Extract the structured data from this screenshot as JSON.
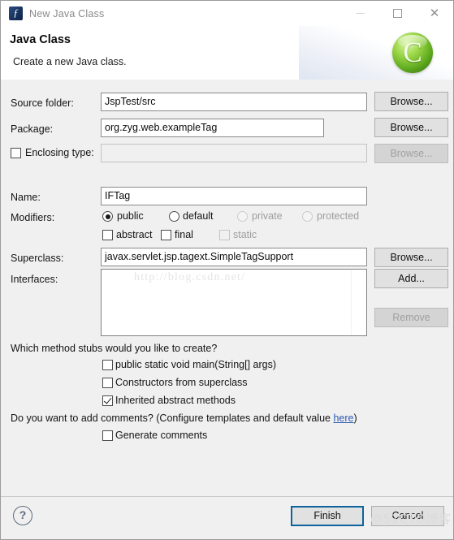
{
  "window": {
    "title": "New Java Class",
    "icon": "java-class-icon",
    "controls": {
      "minimize": "minimize-icon",
      "maximize": "maximize-icon",
      "close": "close-icon"
    }
  },
  "header": {
    "title": "Java Class",
    "subtitle": "Create a new Java class.",
    "logo": "green-c-logo"
  },
  "form": {
    "source_folder": {
      "label": "Source folder:",
      "value": "JspTest/src",
      "button": "Browse..."
    },
    "package": {
      "label": "Package:",
      "value": "org.zyg.web.exampleTag",
      "button": "Browse..."
    },
    "enclosing_type": {
      "label": "Enclosing type:",
      "value": "",
      "checked": false,
      "button": "Browse...",
      "enabled": false
    },
    "name": {
      "label": "Name:",
      "value": "IFTag"
    },
    "modifiers": {
      "label": "Modifiers:",
      "radios": [
        {
          "label": "public",
          "selected": true,
          "enabled": true
        },
        {
          "label": "default",
          "selected": false,
          "enabled": true
        },
        {
          "label": "private",
          "selected": false,
          "enabled": false
        },
        {
          "label": "protected",
          "selected": false,
          "enabled": false
        }
      ],
      "checkboxes": [
        {
          "label": "abstract",
          "checked": false,
          "enabled": true
        },
        {
          "label": "final",
          "checked": false,
          "enabled": true
        },
        {
          "label": "static",
          "checked": false,
          "enabled": false
        }
      ]
    },
    "superclass": {
      "label": "Superclass:",
      "value": "javax.servlet.jsp.tagext.SimpleTagSupport",
      "button": "Browse..."
    },
    "interfaces": {
      "label": "Interfaces:",
      "items": [],
      "add_button": "Add...",
      "remove_button": "Remove",
      "remove_enabled": false,
      "watermark": "http://blog.csdn.net/"
    },
    "method_stubs": {
      "question": "Which method stubs would you like to create?",
      "options": [
        {
          "label": "public static void main(String[] args)",
          "checked": false
        },
        {
          "label": "Constructors from superclass",
          "checked": false
        },
        {
          "label": "Inherited abstract methods",
          "checked": true
        }
      ]
    },
    "comments": {
      "question_prefix": "Do you want to add comments? (Configure templates and default value ",
      "link": "here",
      "question_suffix": ")",
      "option": {
        "label": "Generate comments",
        "checked": false
      }
    }
  },
  "footer": {
    "help": "?",
    "finish": "Finish",
    "cancel": "Cancel",
    "watermark": "@51CTO博客"
  }
}
